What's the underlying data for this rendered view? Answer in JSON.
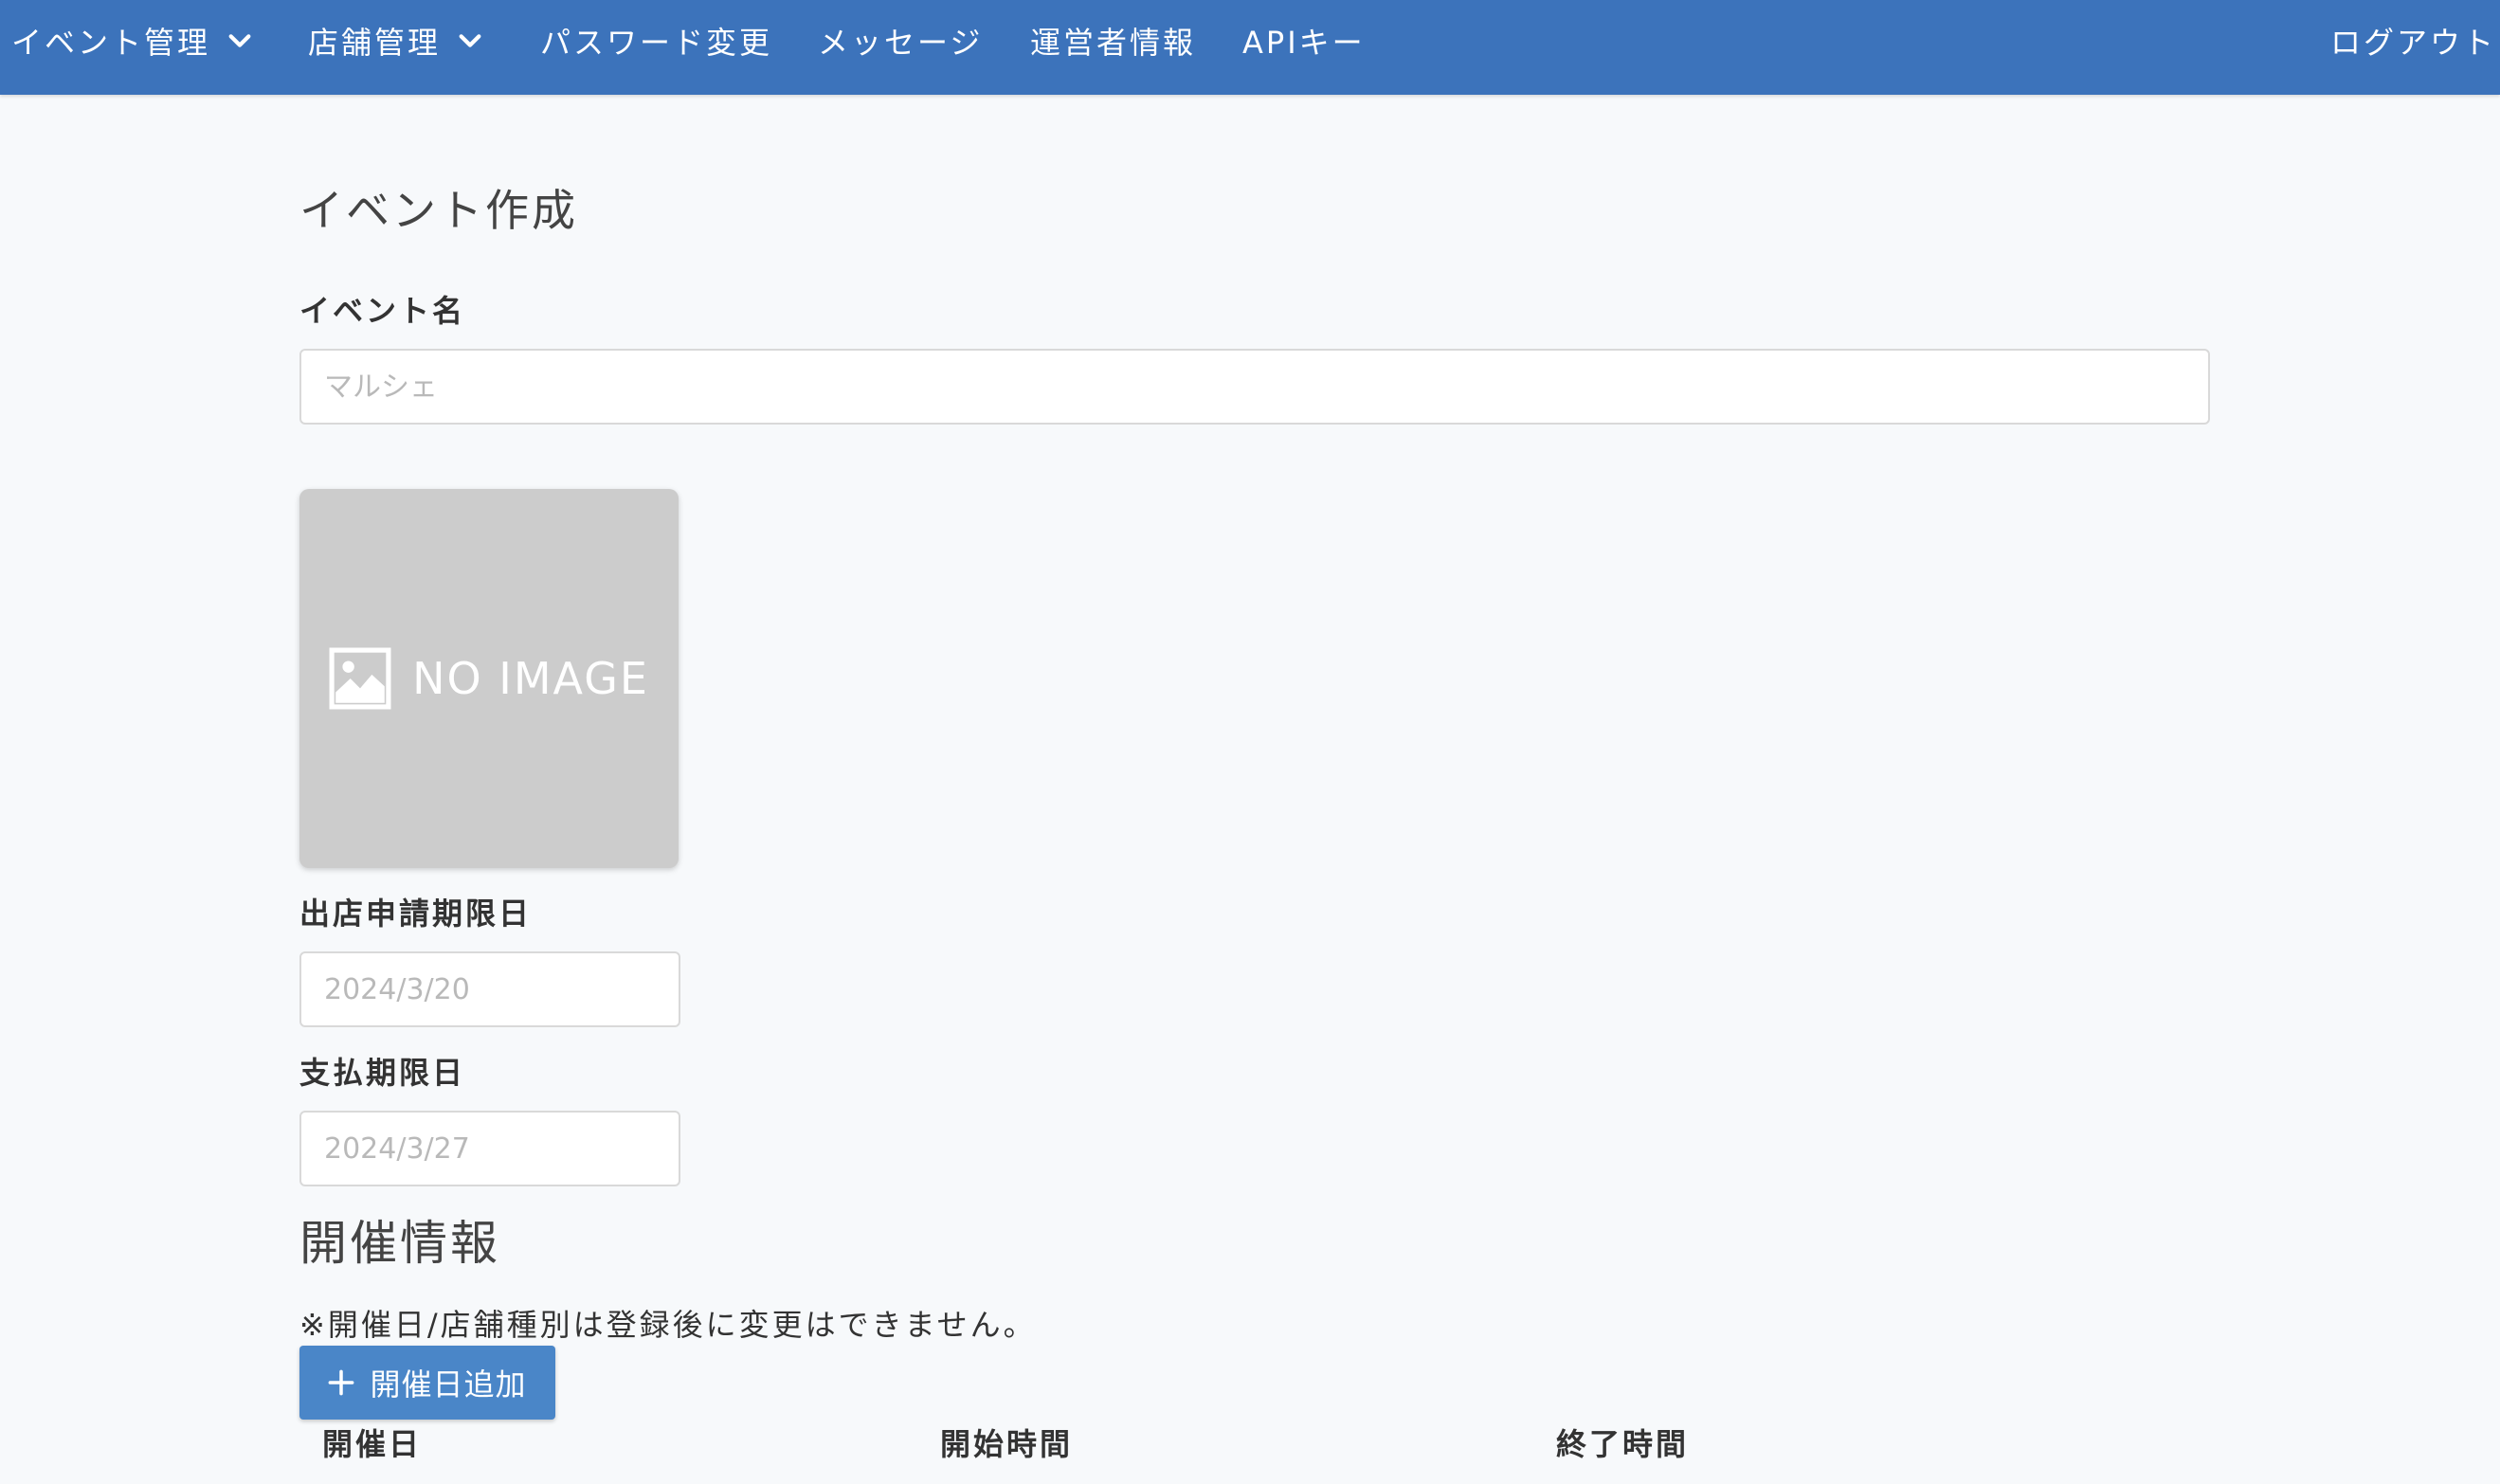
{
  "nav": {
    "event_management": "イベント管理",
    "store_management": "店舗管理",
    "password_change": "パスワード変更",
    "messages": "メッセージ",
    "operator_info": "運営者情報",
    "api_key": "APIキー",
    "logout": "ログアウト"
  },
  "page": {
    "title": "イベント作成"
  },
  "form": {
    "event_name_label": "イベント名",
    "event_name_placeholder": "マルシェ",
    "no_image_text": "NO IMAGE",
    "application_deadline_label": "出店申請期限日",
    "application_deadline_placeholder": "2024/3/20",
    "payment_deadline_label": "支払期限日",
    "payment_deadline_placeholder": "2024/3/27"
  },
  "schedule": {
    "heading": "開催情報",
    "note": "※開催日/店舗種別は登録後に変更はできません。",
    "add_button_label": "開催日追加",
    "columns": [
      "開催日",
      "開始時間",
      "終了時間"
    ]
  },
  "colors": {
    "navbar": "#3c73bb",
    "button": "#4a86c8",
    "background": "#f7f9fb",
    "placeholder_image": "#cccccc"
  },
  "icons": {
    "dropdown": "chevron-down-icon",
    "image": "image-icon",
    "add": "plus-icon"
  }
}
